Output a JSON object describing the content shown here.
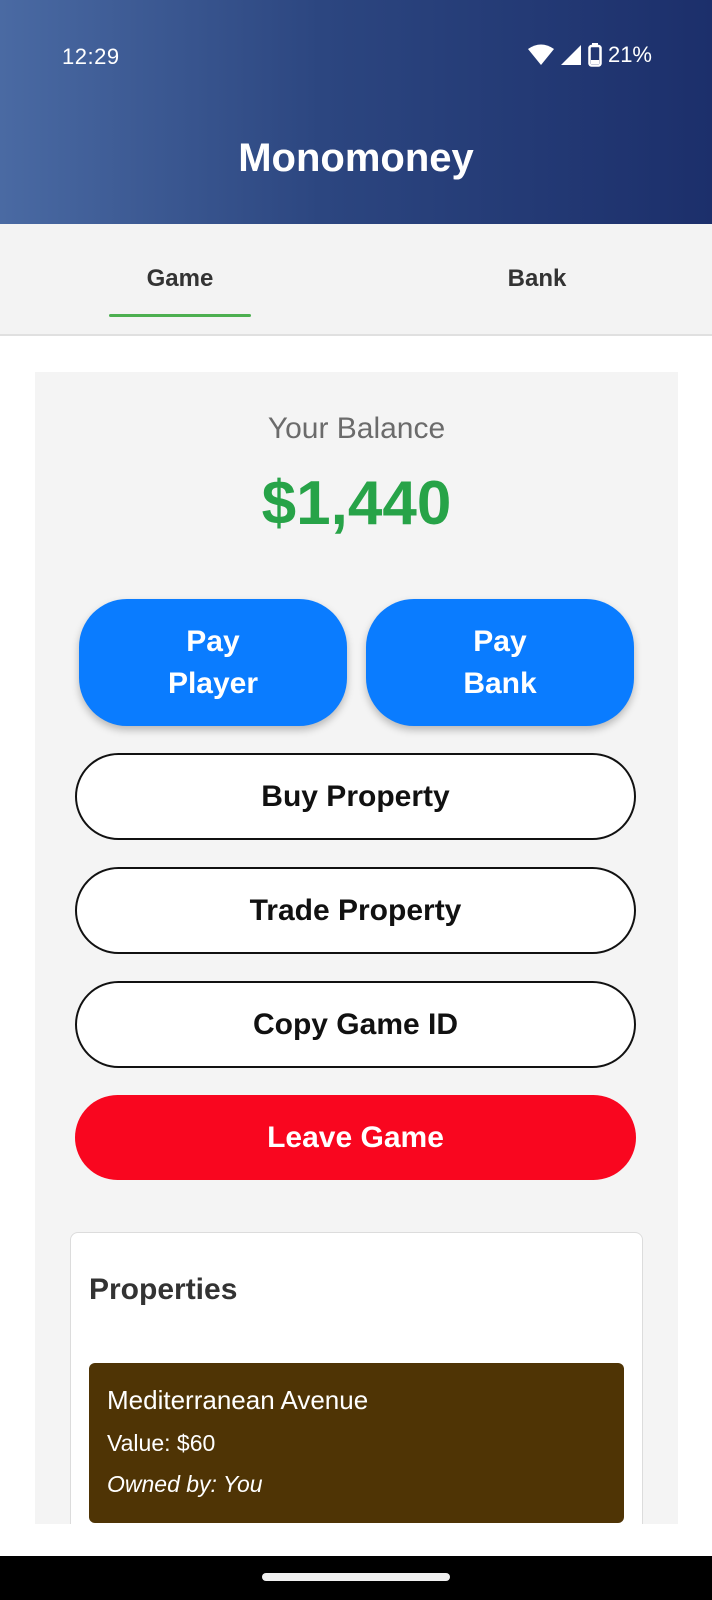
{
  "status_bar": {
    "time": "12:29",
    "battery_percent": "21%",
    "icons": [
      "wifi-icon",
      "cell-signal-icon",
      "battery-icon"
    ]
  },
  "app": {
    "title": "Monomoney",
    "header_gradient": [
      "#4a6aa3",
      "#1c2f6b"
    ]
  },
  "tabs": [
    {
      "label": "Game",
      "active": true
    },
    {
      "label": "Bank",
      "active": false
    }
  ],
  "balance": {
    "label": "Your Balance",
    "value": "$1,440",
    "color": "#27a348"
  },
  "actions": {
    "pay_player": "Pay\nPlayer",
    "pay_bank": "Pay\nBank",
    "buy_property": "Buy Property",
    "trade_property": "Trade Property",
    "copy_game_id": "Copy Game ID",
    "leave_game": "Leave Game"
  },
  "colors": {
    "primary_button": "#0a7cff",
    "danger_button": "#f9061f",
    "tab_indicator": "#4caf50",
    "property_card": "#4f3405"
  },
  "properties": {
    "title": "Properties",
    "items": [
      {
        "name": "Mediterranean Avenue",
        "value": "Value: $60",
        "owner": "Owned by: You"
      }
    ]
  }
}
